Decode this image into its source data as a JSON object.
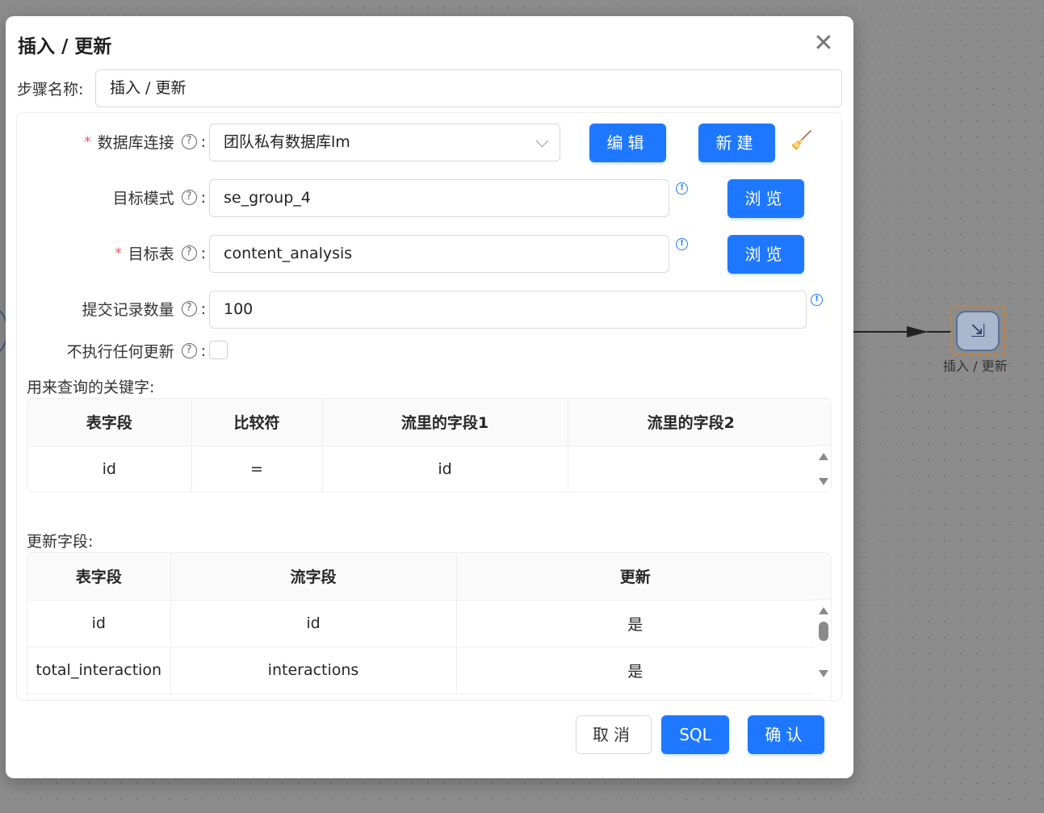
{
  "canvas": {
    "node_label": "插入 / 更新"
  },
  "modal": {
    "title": "插入 / 更新",
    "close_icon": "close-icon"
  },
  "step_name": {
    "label": "步骤名称:",
    "value": "插入 / 更新"
  },
  "form": {
    "db_connection": {
      "label": "数据库连接",
      "value": "团队私有数据库lm",
      "required": true
    },
    "target_schema": {
      "label": "目标模式",
      "value": "se_group_4",
      "required": false
    },
    "target_table": {
      "label": "目标表",
      "value": "content_analysis",
      "required": true
    },
    "commit_size": {
      "label": "提交记录数量",
      "value": "100",
      "required": false
    },
    "no_update": {
      "label": "不执行任何更新",
      "checked": false
    },
    "edit_label": "编辑",
    "new_label": "新建",
    "browse_label": "浏览",
    "help_glyph": "?",
    "info_glyph": "!",
    "colon": ":"
  },
  "key_section": {
    "label": "用来查询的关键字:",
    "columns": [
      "表字段",
      "比较符",
      "流里的字段1",
      "流里的字段2"
    ],
    "rows": [
      [
        "id",
        "=",
        "id",
        ""
      ]
    ]
  },
  "update_section": {
    "label": "更新字段:",
    "columns": [
      "表字段",
      "流字段",
      "更新"
    ],
    "rows": [
      [
        "id",
        "id",
        "是"
      ],
      [
        "total_interaction",
        "interactions",
        "是"
      ]
    ]
  },
  "footer": {
    "cancel_label": "取消",
    "sql_label": "SQL",
    "confirm_label": "确认"
  },
  "colors": {
    "primary": "#1e78ff",
    "required": "#ff4d4f"
  }
}
